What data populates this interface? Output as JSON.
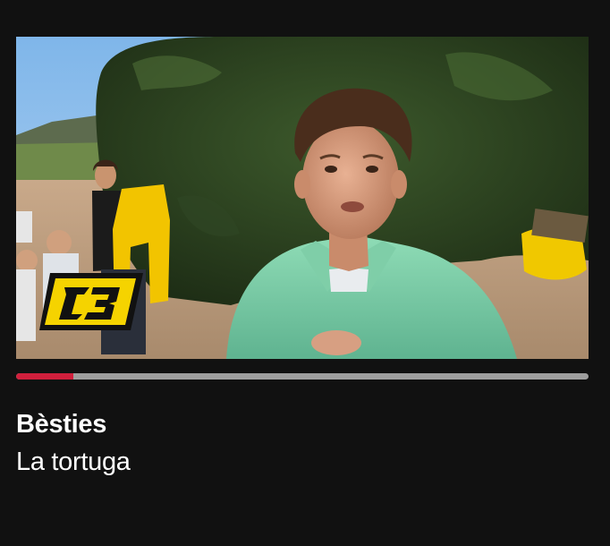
{
  "card": {
    "title": "Bèsties",
    "subtitle": "La tortuga",
    "progress": 0.1,
    "progress_color": "#d11f3c",
    "track_color": "#9e9e9e",
    "background": "#111111",
    "channel_logo": "super3-logo",
    "logo_colors": {
      "fill": "#f5d300",
      "outline": "#111111"
    },
    "logo_text": "3"
  }
}
